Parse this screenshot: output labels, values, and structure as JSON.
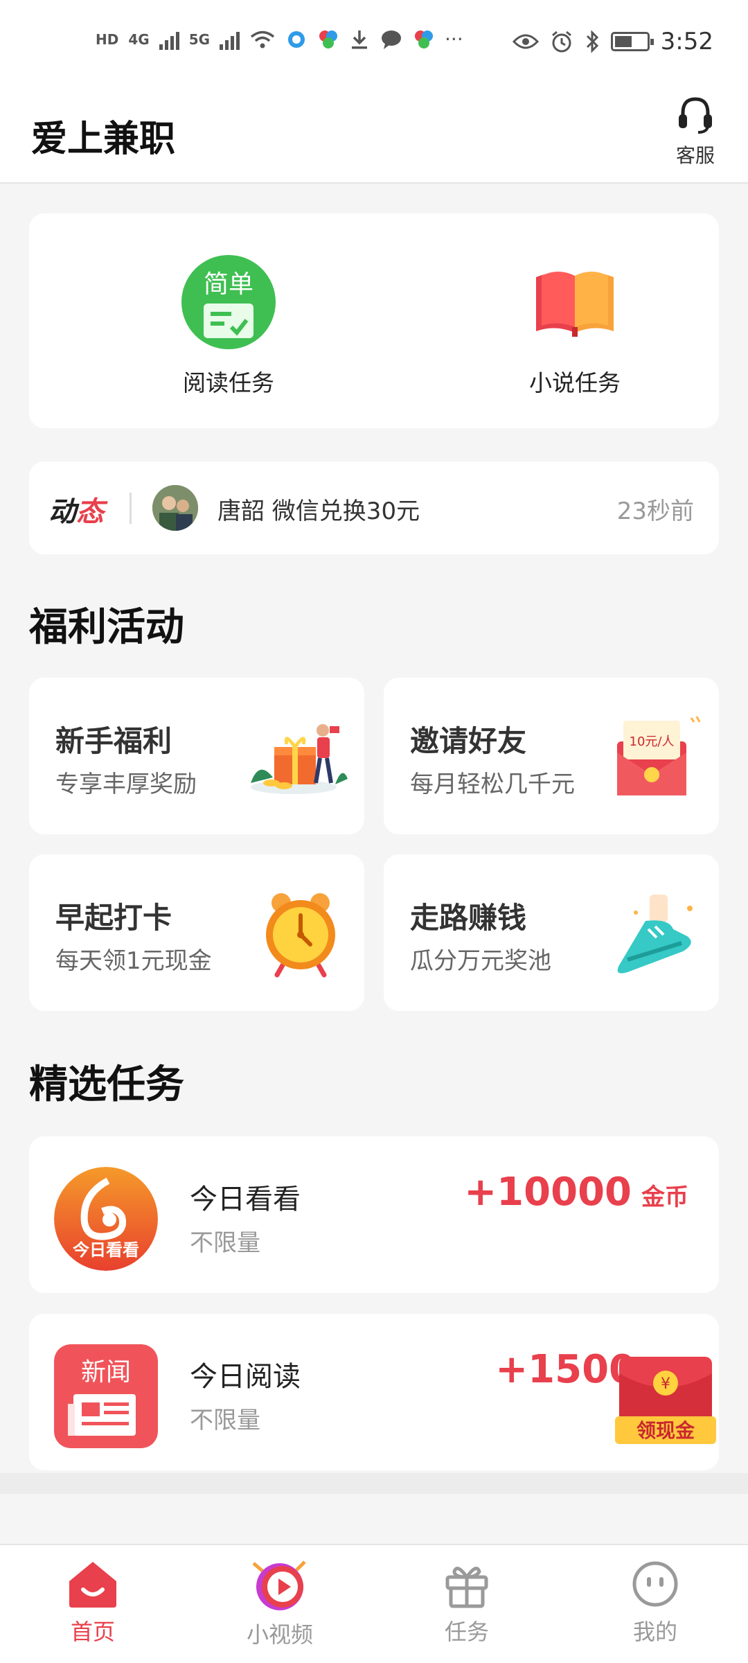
{
  "status_bar": {
    "time": "3:52",
    "hd": "HD",
    "sim1": "4G",
    "sim2": "5G",
    "more": "···",
    "icons": [
      "signal-4g-icon",
      "signal-5g-icon",
      "wifi-icon",
      "app-notification-icon",
      "download-icon",
      "message-icon",
      "eye-icon",
      "alarm-icon",
      "bluetooth-icon",
      "battery-icon"
    ]
  },
  "header": {
    "title": "爱上兼职",
    "service_label": "客服"
  },
  "tasks": [
    {
      "label": "阅读任务",
      "badge": "简单",
      "icon": "reading-task-icon"
    },
    {
      "label": "小说任务",
      "icon": "book-icon"
    }
  ],
  "news": {
    "tag_part1": "动",
    "tag_part2": "态",
    "text": "唐韶 微信兑换30元",
    "time": "23秒前"
  },
  "welfare": {
    "title": "福利活动",
    "items": [
      {
        "title": "新手福利",
        "subtitle": "专享丰厚奖励",
        "icon": "gift-icon"
      },
      {
        "title": "邀请好友",
        "subtitle": "每月轻松几千元",
        "icon": "red-envelope-icon",
        "badge": "10元/人"
      },
      {
        "title": "早起打卡",
        "subtitle": "每天领1元现金",
        "icon": "alarm-clock-icon"
      },
      {
        "title": "走路赚钱",
        "subtitle": "瓜分万元奖池",
        "icon": "sneaker-icon"
      }
    ]
  },
  "featured": {
    "title": "精选任务",
    "items": [
      {
        "name": "今日看看",
        "limit": "不限量",
        "reward": "+10000",
        "unit": "金币",
        "logo_text": "今日看看"
      },
      {
        "name": "今日阅读",
        "limit": "不限量",
        "reward": "+1500",
        "unit": "",
        "logo_text": "新闻"
      }
    ]
  },
  "floating_promo": {
    "label": "领现金"
  },
  "bottom_nav": [
    {
      "label": "首页",
      "active": true
    },
    {
      "label": "小视频",
      "active": false
    },
    {
      "label": "任务",
      "active": false
    },
    {
      "label": "我的",
      "active": false
    }
  ],
  "colors": {
    "accent": "#e8404c",
    "green": "#3fbf52",
    "orange": "#f07a1a"
  }
}
